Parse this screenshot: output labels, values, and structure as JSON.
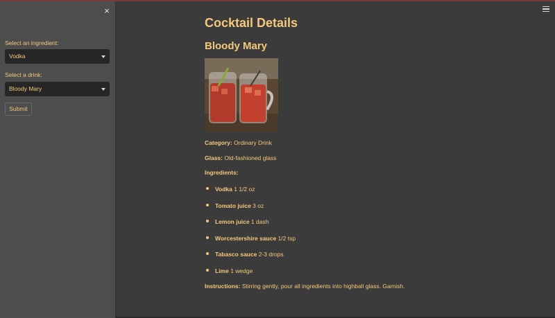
{
  "sidebar": {
    "ingredient_label": "Select an ingredient:",
    "ingredient_value": "Vodka",
    "drink_label": "Select a drink:",
    "drink_value": "Bloody Mary",
    "submit_label": "Submit",
    "close_glyph": "×"
  },
  "main": {
    "title": "Cocktail Details",
    "drink_name": "Bloody Mary",
    "category_label": "Category:",
    "category_value": " Ordinary Drink",
    "glass_label": "Glass:",
    "glass_value": " Old-fashioned glass",
    "ingredients_label": "Ingredients:",
    "ingredients": [
      {
        "name": "Vodka",
        "measure": " 1 1/2 oz"
      },
      {
        "name": "Tomato juice",
        "measure": " 3 oz"
      },
      {
        "name": "Lemon juice",
        "measure": " 1 dash"
      },
      {
        "name": "Worcestershire sauce",
        "measure": " 1/2 tsp"
      },
      {
        "name": "Tabasco sauce",
        "measure": " 2-3 drops"
      },
      {
        "name": "Lime",
        "measure": " 1 wedge"
      }
    ],
    "instructions_label": "Instructions:",
    "instructions_value": " Stirring gently, pour all ingredients into highball glass. Garnish."
  },
  "colors": {
    "accent_text": "#f5c87a",
    "background": "#3b3b3b",
    "sidebar": "#4d4d4d",
    "select_bg": "#262626"
  },
  "icons": [
    "close-icon",
    "chevron-down-icon",
    "hamburger-menu-icon"
  ]
}
